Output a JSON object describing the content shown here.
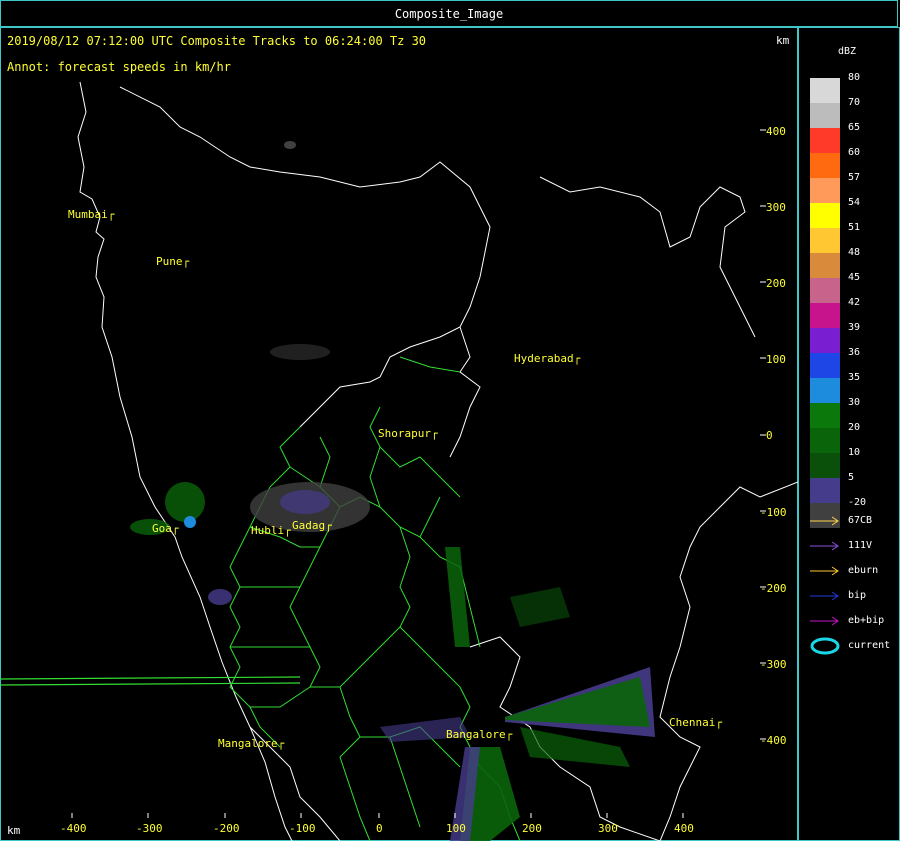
{
  "window": {
    "title": "Composite_Image"
  },
  "header": {
    "line1": "2019/08/12 07:12:00 UTC Composite Tracks to 06:24:00 Tz 30",
    "line2": "Annot: forecast speeds in km/hr",
    "unit_right": "km",
    "unit_bottom": "km"
  },
  "cities": [
    {
      "name": "Mumbai"
    },
    {
      "name": "Pune"
    },
    {
      "name": "Hyderabad"
    },
    {
      "name": "Shorapur"
    },
    {
      "name": "Goa"
    },
    {
      "name": "Hubli"
    },
    {
      "name": "Gadag"
    },
    {
      "name": "Mangalore"
    },
    {
      "name": "Bangalore"
    },
    {
      "name": "Chennai"
    }
  ],
  "y_axis": [
    "400",
    "300",
    "200",
    "100",
    "0",
    "-100",
    "-200",
    "-300",
    "-400"
  ],
  "x_axis": [
    "-400",
    "-300",
    "-200",
    "-100",
    "0",
    "100",
    "200",
    "300",
    "400"
  ],
  "legend": {
    "title": "dBZ",
    "bins": [
      {
        "label": "80",
        "color": "#d8d8d8"
      },
      {
        "label": "70",
        "color": "#bcbcbc"
      },
      {
        "label": "65",
        "color": "#ff3a28"
      },
      {
        "label": "60",
        "color": "#ff6a10"
      },
      {
        "label": "57",
        "color": "#ff9a5a"
      },
      {
        "label": "54",
        "color": "#ffff00"
      },
      {
        "label": "51",
        "color": "#ffc832"
      },
      {
        "label": "48",
        "color": "#d98a3a"
      },
      {
        "label": "45",
        "color": "#c8648c"
      },
      {
        "label": "42",
        "color": "#c8148c"
      },
      {
        "label": "39",
        "color": "#7a1ed2"
      },
      {
        "label": "36",
        "color": "#1e46e6"
      },
      {
        "label": "35",
        "color": "#1e8cdc"
      },
      {
        "label": "30",
        "color": "#0a780a"
      },
      {
        "label": "20",
        "color": "#0a640a"
      },
      {
        "label": "10",
        "color": "#0a500a"
      },
      {
        "label": "5",
        "color": "#463c8c"
      },
      {
        "label": "-20",
        "color": "#404040"
      }
    ],
    "tracks": [
      {
        "label": "67CB",
        "color": "#ffd24a"
      },
      {
        "label": "111V",
        "color": "#8c50dc"
      },
      {
        "label": "eburn",
        "color": "#ffc832"
      },
      {
        "label": "bip",
        "color": "#1e3cdc"
      },
      {
        "label": "eb+bip",
        "color": "#c814c8"
      },
      {
        "label": "current",
        "color": "#19d7e6"
      }
    ]
  }
}
